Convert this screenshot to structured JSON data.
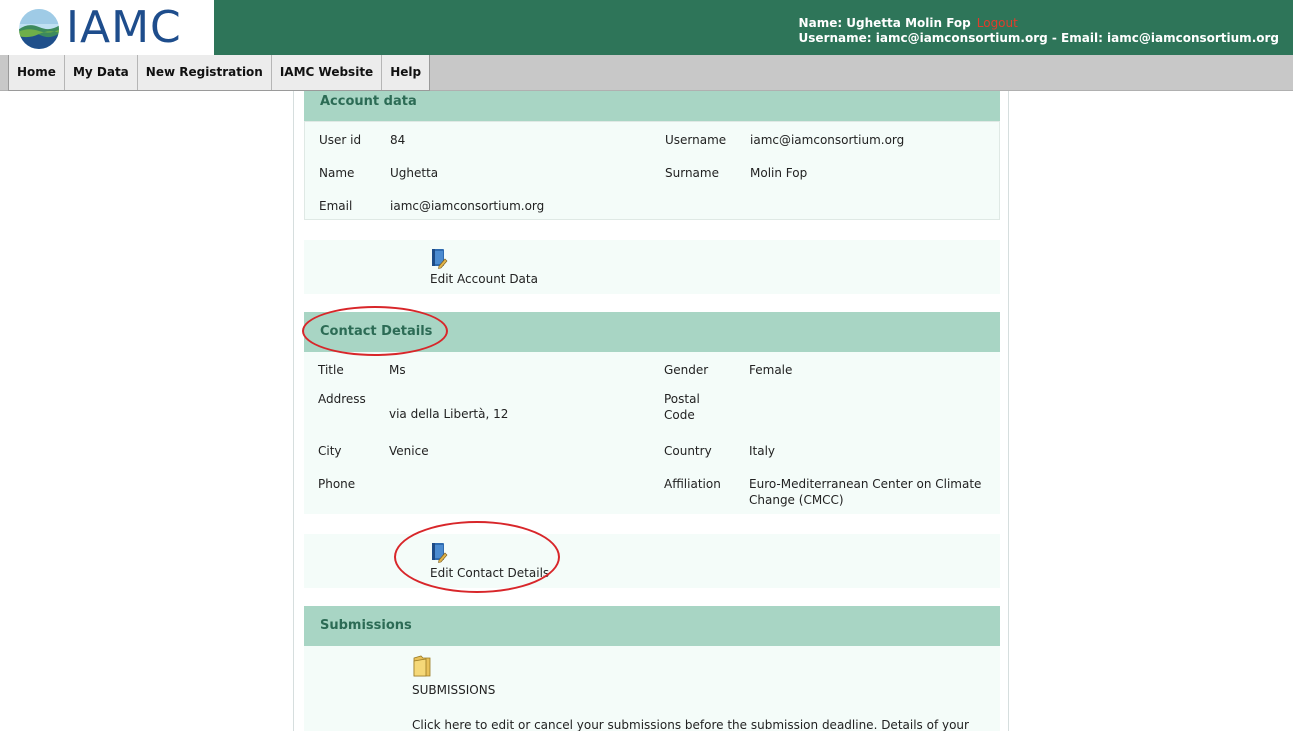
{
  "brand": {
    "logo_text": "IAMC"
  },
  "user": {
    "name_line": "Name: Ughetta Molin Fop",
    "logout": "Logout",
    "account_line": "Username: iamc@iamconsortium.org - Email: iamc@iamconsortium.org"
  },
  "nav": [
    "Home",
    "My Data",
    "New Registration",
    "IAMC Website",
    "Help"
  ],
  "account": {
    "heading": "Account data",
    "user_id_label": "User id",
    "user_id": "84",
    "username_label": "Username",
    "username": "iamc@iamconsortium.org",
    "name_label": "Name",
    "name": "Ughetta",
    "surname_label": "Surname",
    "surname": "Molin Fop",
    "email_label": "Email",
    "email": "iamc@iamconsortium.org",
    "edit_label": "Edit Account Data"
  },
  "contact": {
    "heading": "Contact Details",
    "title_label": "Title",
    "title": "Ms",
    "gender_label": "Gender",
    "gender": "Female",
    "address_label": "Address",
    "address": "via della Libertà, 12",
    "postal_label_1": "Postal",
    "postal_label_2": "Code",
    "postal": "",
    "city_label": "City",
    "city": "Venice",
    "country_label": "Country",
    "country": "Italy",
    "phone_label": "Phone",
    "phone": "",
    "affiliation_label": "Affiliation",
    "affiliation_1": "Euro-Mediterranean Center on Climate",
    "affiliation_2": "Change (CMCC)",
    "edit_label": "Edit Contact Details"
  },
  "submissions": {
    "heading": "Submissions",
    "folder_label": "SUBMISSIONS",
    "description": "Click here to edit or cancel your submissions before the submission deadline. Details of your"
  },
  "colors": {
    "header_green": "#2e7559",
    "section_head": "#a8d5c4",
    "panel_bg": "#f4fcf9",
    "annotation_red": "#d8262a"
  },
  "icons": [
    "iamc-logo-icon",
    "edit-book-icon",
    "folder-icon"
  ]
}
